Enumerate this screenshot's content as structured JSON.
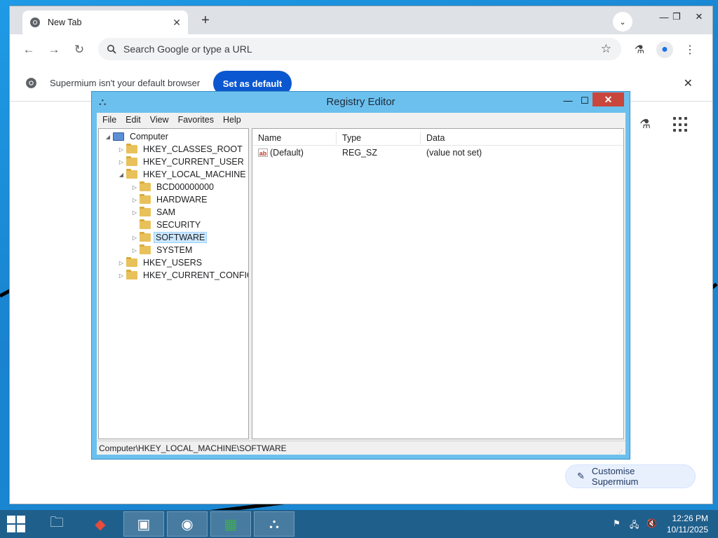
{
  "browser": {
    "tab_title": "New Tab",
    "tab_close": "✕",
    "new_tab": "+",
    "omnibox_placeholder": "Search Google or type a URL",
    "infobar_text": "Supermium isn't your default browser",
    "set_default_label": "Set as default",
    "customise_label": "Customise Supermium"
  },
  "regedit": {
    "title": "Registry Editor",
    "close": "✕",
    "menu": [
      "File",
      "Edit",
      "View",
      "Favorites",
      "Help"
    ],
    "tree": [
      {
        "label": "Computer",
        "level": 0,
        "expander": "◢",
        "icon": "computer-icon"
      },
      {
        "label": "HKEY_CLASSES_ROOT",
        "level": 1,
        "expander": "▷",
        "icon": "folder-icon"
      },
      {
        "label": "HKEY_CURRENT_USER",
        "level": 1,
        "expander": "▷",
        "icon": "folder-icon"
      },
      {
        "label": "HKEY_LOCAL_MACHINE",
        "level": 1,
        "expander": "◢",
        "icon": "folder-icon"
      },
      {
        "label": "BCD00000000",
        "level": 2,
        "expander": "▷",
        "icon": "folder-icon"
      },
      {
        "label": "HARDWARE",
        "level": 2,
        "expander": "▷",
        "icon": "folder-icon"
      },
      {
        "label": "SAM",
        "level": 2,
        "expander": "▷",
        "icon": "folder-icon"
      },
      {
        "label": "SECURITY",
        "level": 2,
        "expander": "",
        "icon": "folder-icon"
      },
      {
        "label": "SOFTWARE",
        "level": 2,
        "expander": "▷",
        "icon": "folder-icon",
        "selected": true
      },
      {
        "label": "SYSTEM",
        "level": 2,
        "expander": "▷",
        "icon": "folder-icon"
      },
      {
        "label": "HKEY_USERS",
        "level": 1,
        "expander": "▷",
        "icon": "folder-icon"
      },
      {
        "label": "HKEY_CURRENT_CONFIG",
        "level": 1,
        "expander": "▷",
        "icon": "folder-icon"
      }
    ],
    "columns": [
      "Name",
      "Type",
      "Data"
    ],
    "rows": [
      {
        "name": "(Default)",
        "type": "REG_SZ",
        "data": "(value not set)"
      }
    ],
    "status_path": "Computer\\HKEY_LOCAL_MACHINE\\SOFTWARE"
  },
  "taskbar": {
    "time": "12:26 PM",
    "date": "10/11/2025"
  },
  "colors": {
    "desktop": "#1a8ad4",
    "regedit_frame": "#6cc0ee",
    "close_red": "#c9463d",
    "accent_blue": "#0b57d0",
    "taskbar": "#1f5f8c"
  }
}
